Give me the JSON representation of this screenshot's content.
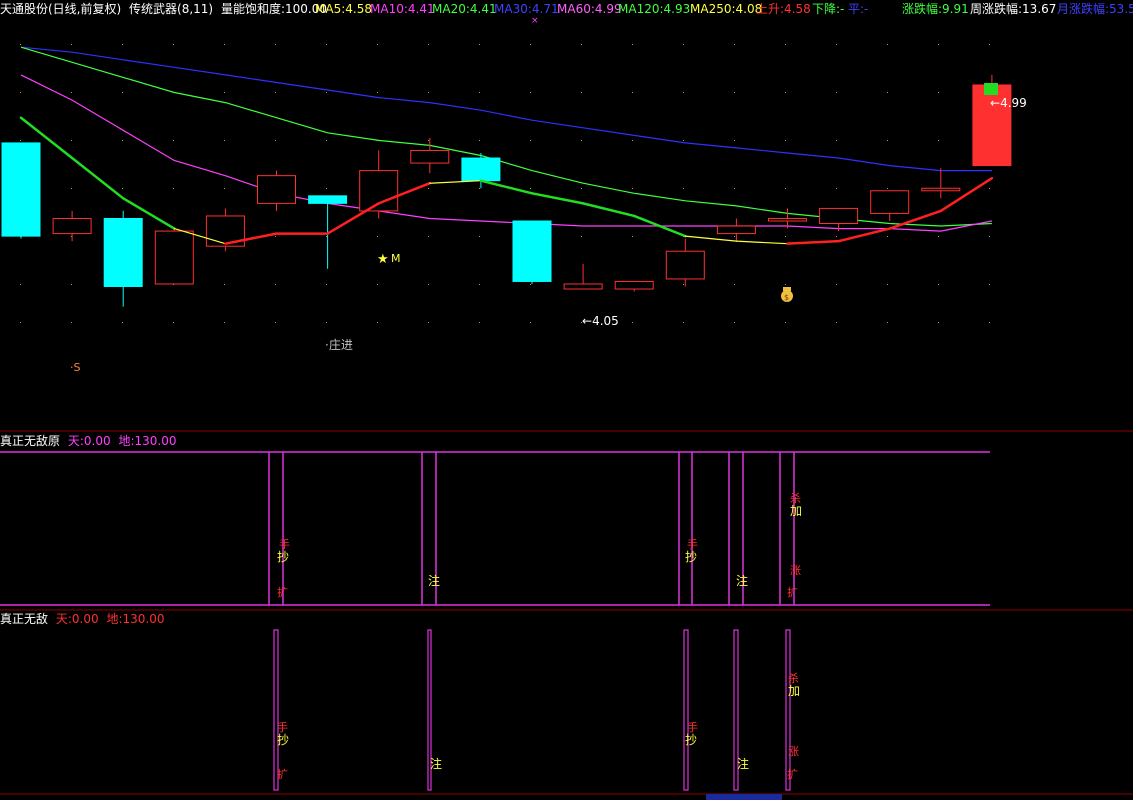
{
  "header": {
    "stock": "天通股份(日线,前复权)",
    "indicator": "传统武器(8,11)",
    "saturation": "量能饱和度:100.00",
    "ma5": "MA5:4.58",
    "ma10": "MA10:4.41",
    "ma20": "MA20:4.41",
    "ma30": "MA30:4.71",
    "ma60": "MA60:4.99",
    "ma120": "MA120:4.93",
    "ma250": "MA250:4.08",
    "up": "上升:4.58",
    "down": "下降:-",
    "flat": "平:-",
    "chg": "涨跌幅:9.91",
    "week_chg": "周涨跌幅:13.67",
    "month_chg": "月涨跌幅:53.5"
  },
  "colors": {
    "up_candle": "#ff3030",
    "down_candle": "#00ffff",
    "ma5": "#ffffff",
    "ma10": "#ff40ff",
    "ma20": "#40ff40",
    "ma30": "#3030ff",
    "trend_green": "#22dd22",
    "trend_red": "#ff2020",
    "trend_yellow": "#ffff40",
    "grid": "#8b0000",
    "signal": "#dd33dd"
  },
  "annotations": {
    "high": "4.99",
    "low": "4.05",
    "star_label": "M",
    "zhuangjin": "庄进",
    "s_mark": "S"
  },
  "panel1": {
    "title": "真正无敌原",
    "tian": "天:0.00",
    "di": "地:130.00"
  },
  "panel2": {
    "title": "真正无敌",
    "tian": "天:0.00",
    "di": "地:130.00"
  },
  "chart_data": {
    "type": "candlestick",
    "ylim": [
      3.72,
      5.3
    ],
    "candles": [
      {
        "open": 4.82,
        "close": 4.45,
        "high": 4.82,
        "low": 4.44
      },
      {
        "open": 4.46,
        "close": 4.52,
        "high": 4.55,
        "low": 4.43
      },
      {
        "open": 4.52,
        "close": 4.25,
        "high": 4.55,
        "low": 4.17
      },
      {
        "open": 4.26,
        "close": 4.47,
        "high": 4.48,
        "low": 4.26
      },
      {
        "open": 4.41,
        "close": 4.53,
        "high": 4.56,
        "low": 4.39
      },
      {
        "open": 4.58,
        "close": 4.69,
        "high": 4.71,
        "low": 4.55
      },
      {
        "open": 4.61,
        "close": 4.58,
        "high": 4.61,
        "low": 4.32
      },
      {
        "open": 4.55,
        "close": 4.71,
        "high": 4.79,
        "low": 4.52
      },
      {
        "open": 4.74,
        "close": 4.79,
        "high": 4.84,
        "low": 4.7
      },
      {
        "open": 4.76,
        "close": 4.67,
        "high": 4.78,
        "low": 4.64
      },
      {
        "open": 4.51,
        "close": 4.27,
        "high": 4.51,
        "low": 4.26
      },
      {
        "open": 4.24,
        "close": 4.26,
        "high": 4.34,
        "low": 4.24
      },
      {
        "open": 4.24,
        "close": 4.27,
        "high": 4.27,
        "low": 4.23
      },
      {
        "open": 4.28,
        "close": 4.39,
        "high": 4.44,
        "low": 4.25
      },
      {
        "open": 4.46,
        "close": 4.49,
        "high": 4.52,
        "low": 4.43
      },
      {
        "open": 4.51,
        "close": 4.52,
        "high": 4.56,
        "low": 4.48
      },
      {
        "open": 4.5,
        "close": 4.56,
        "high": 4.56,
        "low": 4.47
      },
      {
        "open": 4.54,
        "close": 4.63,
        "high": 4.63,
        "low": 4.51
      },
      {
        "open": 4.63,
        "close": 4.64,
        "high": 4.72,
        "low": 4.6
      },
      {
        "open": 4.73,
        "close": 5.05,
        "high": 5.09,
        "low": 4.73
      }
    ],
    "ma_blue": [
      5.2,
      5.18,
      5.15,
      5.12,
      5.09,
      5.06,
      5.03,
      5.0,
      4.98,
      4.95,
      4.91,
      4.88,
      4.85,
      4.82,
      4.8,
      4.78,
      4.76,
      4.73,
      4.71,
      4.71
    ],
    "ma_green": [
      5.2,
      5.14,
      5.08,
      5.02,
      4.98,
      4.92,
      4.86,
      4.83,
      4.81,
      4.77,
      4.71,
      4.66,
      4.62,
      4.59,
      4.57,
      4.54,
      4.52,
      4.5,
      4.49,
      4.5
    ],
    "ma_magenta": [
      5.09,
      4.99,
      4.87,
      4.75,
      4.69,
      4.62,
      4.58,
      4.55,
      4.52,
      4.51,
      4.5,
      4.49,
      4.49,
      4.49,
      4.49,
      4.49,
      4.48,
      4.48,
      4.47,
      4.51
    ],
    "trend": [
      4.92,
      null,
      4.6,
      4.48,
      4.42,
      4.46,
      4.46,
      4.58,
      4.66,
      4.67,
      4.62,
      4.58,
      4.53,
      4.45,
      4.43,
      4.42,
      4.43,
      4.48,
      4.55,
      4.68
    ],
    "trend_color": [
      "g",
      "g",
      "g",
      "g",
      "y",
      "r",
      "r",
      "r",
      "r",
      "y",
      "g",
      "g",
      "g",
      "g",
      "y",
      "y",
      "r",
      "r",
      "r",
      "r"
    ]
  }
}
